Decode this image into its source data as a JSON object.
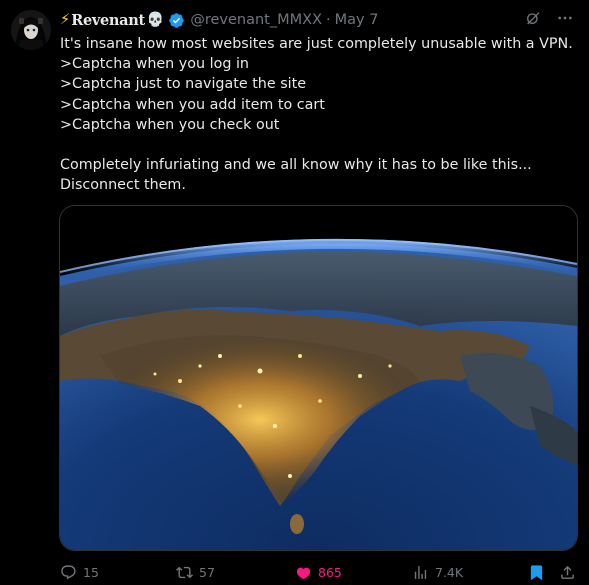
{
  "author": {
    "display_name": "Revenant",
    "handle": "@revenant_MMXX",
    "separator": "·",
    "date": "May 7"
  },
  "tweet": {
    "lines": [
      "It's insane how most websites are just completely unusable with a VPN.",
      ">Captcha when you log in",
      ">Captcha just to navigate the site",
      ">Captcha when you add item to cart",
      ">Captcha when you check out",
      "",
      "Completely infuriating and we all know why it has to be like this...",
      "Disconnect them."
    ]
  },
  "actions": {
    "replies": "15",
    "reposts": "57",
    "likes": "865",
    "views": "7.4K"
  },
  "colors": {
    "accent": "#1d9bf0",
    "like": "#f91880",
    "muted": "#71767b",
    "bolt": "#ffd21f"
  },
  "icons": [
    "lightning-bolt-icon",
    "skull-icon",
    "verified-badge-icon",
    "grok-icon",
    "more-icon",
    "reply-icon",
    "repost-icon",
    "heart-icon",
    "views-icon",
    "bookmark-icon",
    "share-icon"
  ]
}
